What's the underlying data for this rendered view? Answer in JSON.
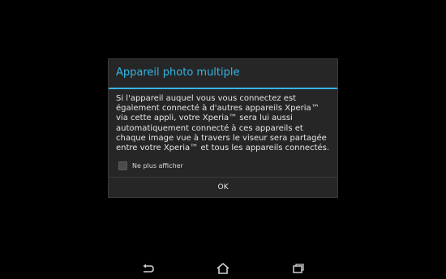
{
  "dialog": {
    "title": "Appareil photo multiple",
    "message": "Si l'appareil auquel vous vous connectez est également connecté à d'autres appareils Xperia™ via cette appli, votre Xperia™ sera lui aussi automatiquement connecté à ces appareils et chaque image vue à travers le viseur sera partagée entre votre Xperia™ et tous les appareils connectés.",
    "checkbox_label": "Ne plus afficher",
    "checkbox_checked": false,
    "ok_label": "OK"
  },
  "navbar": {
    "icons": [
      "back-icon",
      "home-icon",
      "recent-apps-icon"
    ]
  },
  "colors": {
    "accent": "#33b5e5",
    "dialog_bg": "#262626",
    "screen_bg": "#000000"
  }
}
